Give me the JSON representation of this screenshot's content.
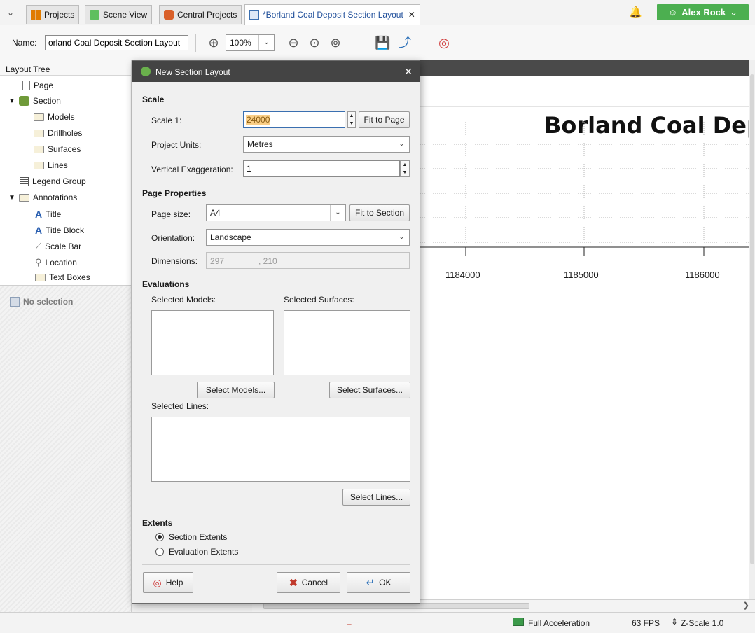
{
  "tabs": [
    {
      "label": "Projects"
    },
    {
      "label": "Scene View"
    },
    {
      "label": "Central Projects"
    },
    {
      "label": "*Borland Coal Deposit Section Layout"
    }
  ],
  "user": {
    "name": "Alex Rock"
  },
  "toolbar": {
    "name_label": "Name:",
    "name_value": "orland Coal Deposit Section Layout",
    "zoom_value": "100%"
  },
  "tree": {
    "title": "Layout Tree",
    "items": [
      {
        "label": "Page"
      },
      {
        "label": "Section"
      },
      {
        "label": "Models"
      },
      {
        "label": "Drillholes"
      },
      {
        "label": "Surfaces"
      },
      {
        "label": "Lines"
      },
      {
        "label": "Legend Group"
      },
      {
        "label": "Annotations"
      },
      {
        "label": "Title"
      },
      {
        "label": "Title Block"
      },
      {
        "label": "Scale Bar"
      },
      {
        "label": "Location"
      },
      {
        "label": "Text Boxes"
      }
    ]
  },
  "properties": {
    "empty_text": "No selection"
  },
  "canvas": {
    "title": "Borland Coal Dep",
    "axis_ticks": [
      "1184000",
      "1185000",
      "1186000"
    ]
  },
  "dialog": {
    "title": "New Section Layout",
    "scale_header": "Scale",
    "scale_label": "Scale 1:",
    "scale_value": "24000",
    "fit_to_page": "Fit to Page",
    "project_units_label": "Project Units:",
    "project_units_value": "Metres",
    "vert_exag_label": "Vertical Exaggeration:",
    "vert_exag_value": "1",
    "page_header": "Page Properties",
    "page_size_label": "Page size:",
    "page_size_value": "A4",
    "fit_to_section": "Fit to Section",
    "orientation_label": "Orientation:",
    "orientation_value": "Landscape",
    "dimensions_label": "Dimensions:",
    "dim_w": "297",
    "dim_h": ", 210",
    "eval_header": "Evaluations",
    "selected_models_label": "Selected Models:",
    "selected_surfaces_label": "Selected Surfaces:",
    "select_models": "Select Models...",
    "select_surfaces": "Select Surfaces...",
    "selected_lines_label": "Selected Lines:",
    "select_lines": "Select Lines...",
    "extents_header": "Extents",
    "section_extents": "Section Extents",
    "evaluation_extents": "Evaluation Extents",
    "help": "Help",
    "cancel": "Cancel",
    "ok": "OK"
  },
  "status": {
    "acceleration": "Full Acceleration",
    "fps": "63 FPS",
    "zscale": "Z-Scale 1.0"
  },
  "colors": {
    "accent_green": "#4caf50",
    "title_bar": "#444444",
    "highlight": "#f5a623"
  }
}
